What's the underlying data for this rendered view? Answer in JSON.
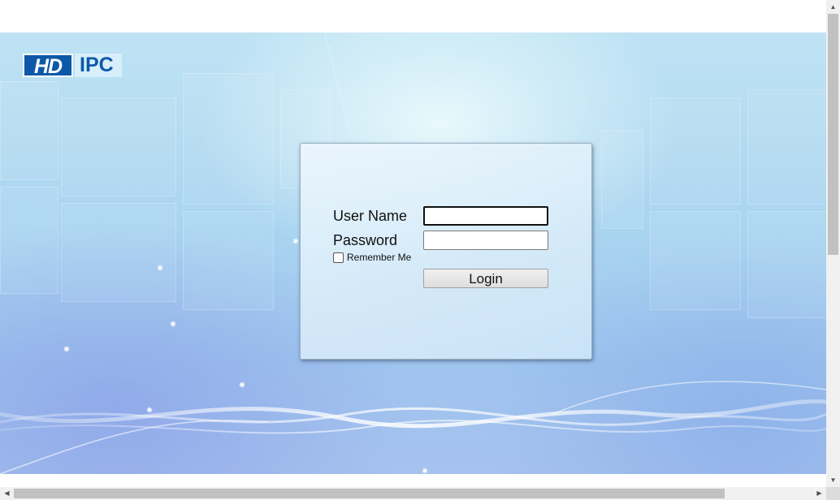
{
  "brand": {
    "logo_left": "HD",
    "logo_right": "IPC",
    "color_primary": "#0d58a8"
  },
  "login": {
    "username_label": "User Name",
    "username_value": "",
    "password_label": "Password",
    "password_value": "",
    "remember_label": "Remember Me",
    "remember_checked": false,
    "login_button": "Login"
  },
  "scrollbars": {
    "vertical_up_icon": "arrow-up-icon",
    "vertical_down_icon": "arrow-down-icon",
    "horizontal_left_icon": "arrow-left-icon",
    "horizontal_right_icon": "arrow-right-icon"
  }
}
